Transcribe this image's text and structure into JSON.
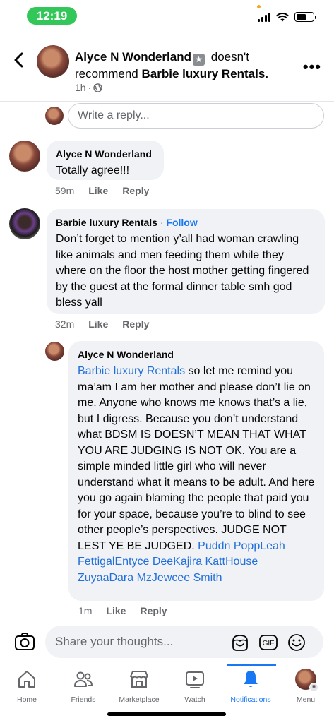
{
  "status_bar": {
    "time": "12:19"
  },
  "header": {
    "author": "Alyce N Wonderland",
    "action_text": "doesn't recommend",
    "page": "Barbie luxury Rentals.",
    "time": "1h",
    "more_icon": "more-horizontal-icon"
  },
  "reply": {
    "placeholder": "Write a reply..."
  },
  "comments": [
    {
      "author": "Alyce N Wonderland",
      "text": "Totally agree!!!",
      "time": "59m",
      "like": "Like",
      "reply": "Reply"
    },
    {
      "author": "Barbie luxury Rentals",
      "follow": "Follow",
      "text": "Don’t forget to mention y’all had woman crawling like animals and men feeding them while they where on the floor the host mother getting fingered by the guest at the formal dinner table smh god bless yall",
      "time": "32m",
      "like": "Like",
      "reply": "Reply"
    },
    {
      "author": "Alyce N Wonderland",
      "mention": "Barbie luxury Rentals",
      "text": " so let me remind you ma’am I am her mother and please don’t lie on me. Anyone who knows me knows that’s a lie, but I digress. Because you don’t understand what BDSM IS DOESN’T MEAN THAT WHAT YOU ARE JUDGING IS NOT OK. You are a simple minded little girl who will never understand what it means to be adult. And here you go again blaming the people that paid you for your space, because you’re to blind to see other people’s perspectives. JUDGE NOT LEST YE BE JUDGED. ",
      "mentions_end": "Puddn PoppLeah FettigalEntyce DeeKajira KattHouse ZuyaaDara MzJewcee Smith",
      "time": "1m",
      "like": "Like",
      "reply": "Reply"
    }
  ],
  "composer": {
    "placeholder": "Share your thoughts..."
  },
  "tabs": [
    {
      "label": "Home",
      "icon": "home-icon"
    },
    {
      "label": "Friends",
      "icon": "friends-icon"
    },
    {
      "label": "Marketplace",
      "icon": "marketplace-icon"
    },
    {
      "label": "Watch",
      "icon": "watch-icon"
    },
    {
      "label": "Notifications",
      "icon": "bell-icon",
      "active": true
    },
    {
      "label": "Menu",
      "icon": "avatar-menu-icon"
    }
  ],
  "colors": {
    "accent": "#1877f2",
    "status_pill": "#33c759",
    "bubble": "#f0f2f5",
    "muted": "#65676b"
  }
}
